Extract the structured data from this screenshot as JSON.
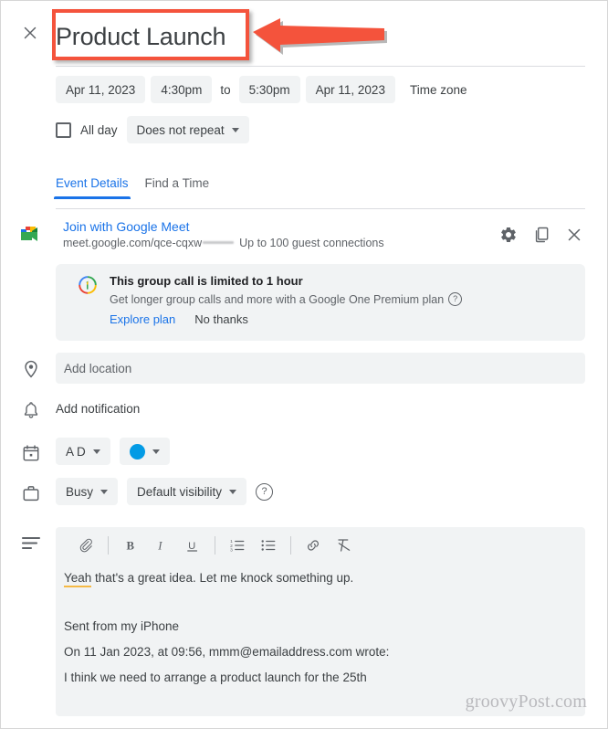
{
  "header": {
    "close_icon": "close-icon",
    "title_value": "Product Launch",
    "title_placeholder": "Add title"
  },
  "annotation": {
    "box_color": "#f4533c",
    "arrow_color": "#f4533c",
    "arrow_direction": "left"
  },
  "schedule": {
    "start_date": "Apr 11, 2023",
    "start_time": "4:30pm",
    "to_label": "to",
    "end_time": "5:30pm",
    "end_date": "Apr 11, 2023",
    "timezone_label": "Time zone",
    "all_day_label": "All day",
    "all_day_checked": false,
    "repeat_value": "Does not repeat"
  },
  "tabs": [
    {
      "label": "Event Details",
      "active": true
    },
    {
      "label": "Find a Time",
      "active": false
    }
  ],
  "meet": {
    "icon": "google-meet-icon",
    "join_label": "Join with Google Meet",
    "url": "meet.google.com/qce-cqxw",
    "url_redacted": true,
    "guest_note": "Up to 100 guest connections",
    "actions": [
      {
        "name": "settings-gear-icon",
        "label": "Meet settings"
      },
      {
        "name": "copy-icon",
        "label": "Copy conferencing info"
      },
      {
        "name": "remove-conferencing-icon",
        "label": "Remove conferencing"
      }
    ]
  },
  "banner": {
    "icon": "google-one-icon",
    "title": "This group call is limited to 1 hour",
    "subtitle": "Get longer group calls and more with a Google One Premium plan",
    "help_icon": "help-circle-icon",
    "primary_action": "Explore plan",
    "secondary_action": "No thanks"
  },
  "location": {
    "icon": "location-pin-icon",
    "placeholder": "Add location",
    "value": ""
  },
  "notification": {
    "icon": "bell-icon",
    "label": "Add notification"
  },
  "calendar": {
    "icon": "calendar-icon",
    "owner": "A D",
    "color_label": "Peacock",
    "color_hex": "#039be5"
  },
  "availability": {
    "icon": "briefcase-icon",
    "busy_value": "Busy",
    "visibility_value": "Default visibility",
    "help_icon": "help-circle-icon"
  },
  "description": {
    "icon": "description-lines-icon",
    "toolbar": [
      {
        "name": "attach-icon",
        "label": "Attach file"
      },
      {
        "name": "bold-icon",
        "label": "B"
      },
      {
        "name": "italic-icon",
        "label": "I"
      },
      {
        "name": "underline-icon",
        "label": "U"
      },
      {
        "name": "numbered-list-icon",
        "label": "Numbered list"
      },
      {
        "name": "bulleted-list-icon",
        "label": "Bulleted list"
      },
      {
        "name": "link-icon",
        "label": "Insert link"
      },
      {
        "name": "remove-formatting-icon",
        "label": "Remove formatting"
      }
    ],
    "paragraphs": [
      {
        "misspelled": "Yeah",
        "rest": " that's a great idea. Let me knock something up."
      },
      {
        "text": "Sent from my iPhone"
      },
      {
        "text": "On 11 Jan 2023, at 09:56, mmm@emailaddress.com wrote:"
      },
      {
        "text": "I think we need to arrange a product launch for the 25th"
      }
    ]
  },
  "watermark": {
    "text": "groovyPost.com"
  }
}
